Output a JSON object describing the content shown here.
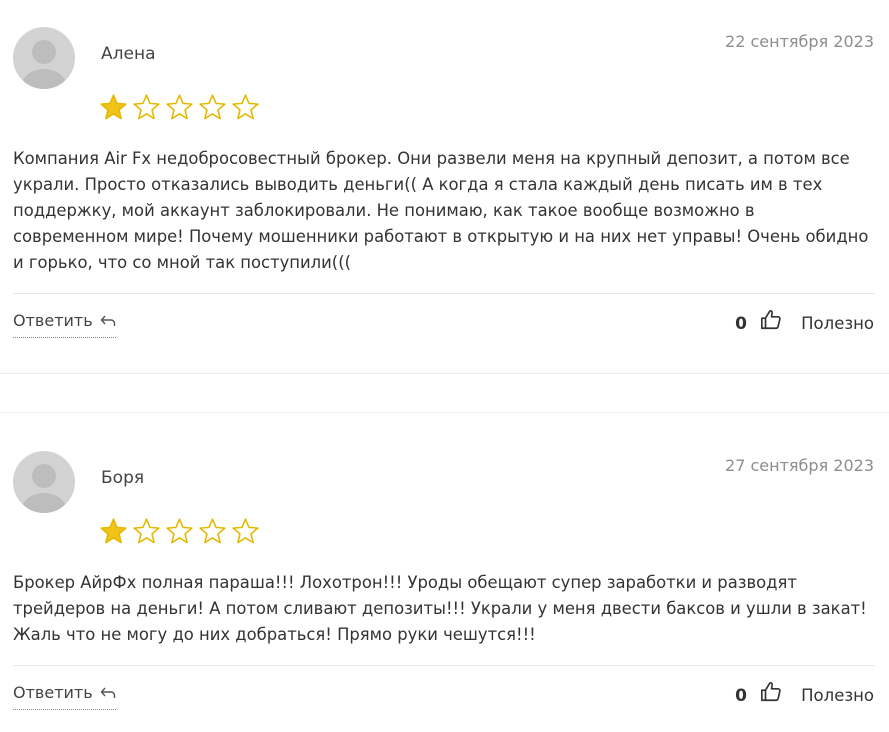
{
  "reviews": [
    {
      "author": "Алена",
      "date": "22 сентября 2023",
      "rating": 1,
      "max_rating": 5,
      "text": "Компания Air Fx недобросовестный брокер. Они развели меня на крупный депозит, а потом все украли. Просто отказались выводить деньги(( А когда я стала каждый день писать им в тех поддержку, мой аккаунт заблокировали. Не понимаю, как такое вообще возможно в современном мире! Почему мошенники работают в открытую и на них нет управы! Очень обидно и горько, что со мной так поступили(((",
      "reply_label": "Ответить",
      "helpful_count": "0",
      "helpful_label": "Полезно"
    },
    {
      "author": "Боря",
      "date": "27 сентября 2023",
      "rating": 1,
      "max_rating": 5,
      "text": "Брокер АйрФх полная параша!!! Лохотрон!!! Уроды обещают супер заработки и разводят трейдеров на деньги! А потом сливают депозиты!!! Украли у меня двести баксов и ушли в закат! Жаль что не могу до них добраться! Прямо руки чешутся!!!",
      "reply_label": "Ответить",
      "helpful_count": "0",
      "helpful_label": "Полезно"
    }
  ],
  "colors": {
    "star_fill": "#f0c419",
    "star_outline": "#e5b800",
    "avatar_bg": "#d3d3d3",
    "date": "#8e8e8e",
    "divider": "#e8e8e8"
  }
}
